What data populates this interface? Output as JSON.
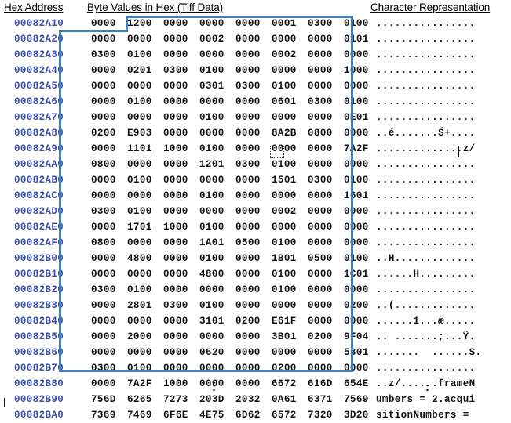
{
  "headers": {
    "address": "Hex Address",
    "bytes": "Byte Values in Hex (Tiff Data)",
    "chars": "Character Representation"
  },
  "colors": {
    "address_text": "#3b4ea8",
    "byte_text": "#111111",
    "selection_border": "#447fb3",
    "background": "#ffffff"
  },
  "continuation": {
    "hex": ":",
    "chars": ":"
  },
  "rows": [
    {
      "address": "00082A10",
      "groups": [
        "0000",
        "1200",
        "0000",
        "0000",
        "0000",
        "0001",
        "0300",
        "0100"
      ],
      "chars": "................"
    },
    {
      "address": "00082A20",
      "groups": [
        "0000",
        "0000",
        "0000",
        "0002",
        "0000",
        "0000",
        "0000",
        "0101"
      ],
      "chars": "................"
    },
    {
      "address": "00082A30",
      "groups": [
        "0300",
        "0100",
        "0000",
        "0000",
        "0000",
        "0002",
        "0000",
        "0000"
      ],
      "chars": "................"
    },
    {
      "address": "00082A40",
      "groups": [
        "0000",
        "0201",
        "0300",
        "0100",
        "0000",
        "0000",
        "0000",
        "1000"
      ],
      "chars": "................"
    },
    {
      "address": "00082A50",
      "groups": [
        "0000",
        "0000",
        "0000",
        "0301",
        "0300",
        "0100",
        "0000",
        "0000"
      ],
      "chars": "................"
    },
    {
      "address": "00082A60",
      "groups": [
        "0000",
        "0100",
        "0000",
        "0000",
        "0000",
        "0601",
        "0300",
        "0100"
      ],
      "chars": "................"
    },
    {
      "address": "00082A70",
      "groups": [
        "0000",
        "0000",
        "0000",
        "0100",
        "0000",
        "0000",
        "0000",
        "0E01"
      ],
      "chars": "................"
    },
    {
      "address": "00082A80",
      "groups": [
        "0200",
        "E903",
        "0000",
        "0000",
        "0000",
        "8A2B",
        "0800",
        "0000"
      ],
      "chars": "..é.......Š+...."
    },
    {
      "address": "00082A90",
      "groups": [
        "0000",
        "1101",
        "1000",
        "0100",
        "0000",
        "0000",
        "0000",
        "7A2F"
      ],
      "chars": "..............z/"
    },
    {
      "address": "00082AA0",
      "groups": [
        "0800",
        "0000",
        "0000",
        "1201",
        "0300",
        "0100",
        "0000",
        "0000"
      ],
      "chars": "................"
    },
    {
      "address": "00082AB0",
      "groups": [
        "0000",
        "0100",
        "0000",
        "0000",
        "0000",
        "1501",
        "0300",
        "0100"
      ],
      "chars": "................"
    },
    {
      "address": "00082AC0",
      "groups": [
        "0000",
        "0000",
        "0000",
        "0100",
        "0000",
        "0000",
        "0000",
        "1601"
      ],
      "chars": "................"
    },
    {
      "address": "00082AD0",
      "groups": [
        "0300",
        "0100",
        "0000",
        "0000",
        "0000",
        "0002",
        "0000",
        "0000"
      ],
      "chars": "................"
    },
    {
      "address": "00082AE0",
      "groups": [
        "0000",
        "1701",
        "1000",
        "0100",
        "0000",
        "0000",
        "0000",
        "0000"
      ],
      "chars": "................"
    },
    {
      "address": "00082AF0",
      "groups": [
        "0800",
        "0000",
        "0000",
        "1A01",
        "0500",
        "0100",
        "0000",
        "0000"
      ],
      "chars": "................"
    },
    {
      "address": "00082B00",
      "groups": [
        "0000",
        "4800",
        "0000",
        "0100",
        "0000",
        "1B01",
        "0500",
        "0100"
      ],
      "chars": "..H............."
    },
    {
      "address": "00082B10",
      "groups": [
        "0000",
        "0000",
        "0000",
        "4800",
        "0000",
        "0100",
        "0000",
        "1C01"
      ],
      "chars": "......H........."
    },
    {
      "address": "00082B20",
      "groups": [
        "0300",
        "0100",
        "0000",
        "0000",
        "0000",
        "0100",
        "0000",
        "0000"
      ],
      "chars": "................"
    },
    {
      "address": "00082B30",
      "groups": [
        "0000",
        "2801",
        "0300",
        "0100",
        "0000",
        "0000",
        "0000",
        "0200"
      ],
      "chars": "..(............."
    },
    {
      "address": "00082B40",
      "groups": [
        "0000",
        "0000",
        "0000",
        "3101",
        "0200",
        "E61F",
        "0000",
        "0000"
      ],
      "chars": "......1...æ....."
    },
    {
      "address": "00082B50",
      "groups": [
        "0000",
        "2000",
        "0000",
        "0000",
        "0000",
        "3B01",
        "0200",
        "9F04"
      ],
      "chars": ".. .......;...Ÿ."
    },
    {
      "address": "00082B60",
      "groups": [
        "0000",
        "0000",
        "0000",
        "0620",
        "0000",
        "0000",
        "0000",
        "5301"
      ],
      "chars": ".......  ......S."
    },
    {
      "address": "00082B70",
      "groups": [
        "0300",
        "0100",
        "0000",
        "0000",
        "0000",
        "0200",
        "0000",
        "0000"
      ],
      "chars": "................"
    },
    {
      "address": "00082B80",
      "groups": [
        "0000",
        "7A2F",
        "1000",
        "0000",
        "0000",
        "6672",
        "616D",
        "654E"
      ],
      "chars": "..z/......frameN"
    },
    {
      "address": "00082B90",
      "groups": [
        "756D",
        "6265",
        "7273",
        "203D",
        "2032",
        "0A61",
        "6371",
        "7569"
      ],
      "chars": "umbers = 2.acqui"
    },
    {
      "address": "00082BA0",
      "groups": [
        "7369",
        "7469",
        "6F6E",
        "4E75",
        "6D62",
        "6572",
        "7320",
        "3D20"
      ],
      "chars": "sitionNumbers = "
    }
  ],
  "cursor": {
    "hex_cell_value": "00",
    "hex_cell_row_address": "00082AA0",
    "char_caret_row_address": "00082AA0"
  }
}
